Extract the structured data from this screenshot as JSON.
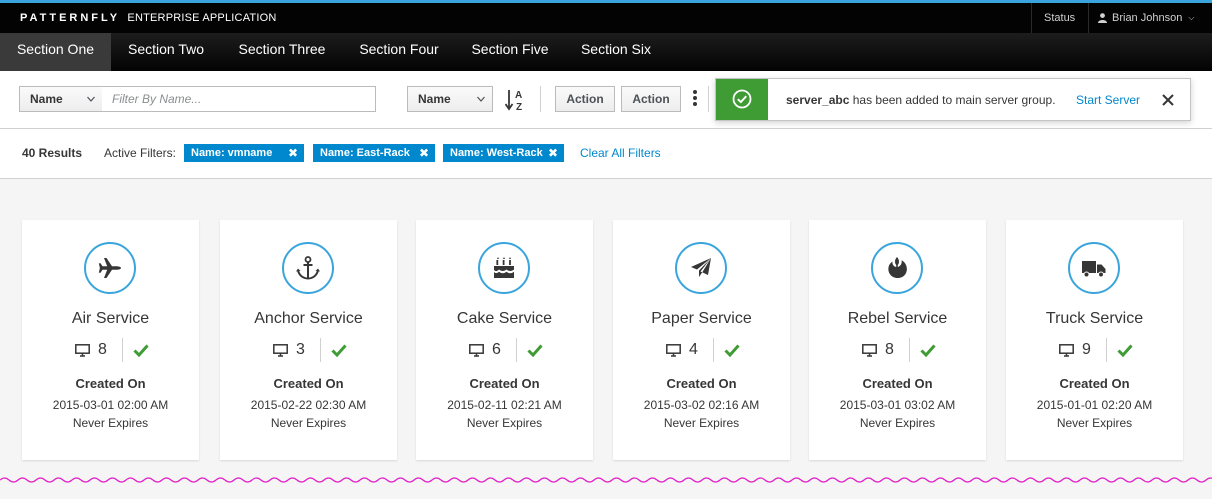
{
  "header": {
    "brand_main": "PATTERNFLY",
    "brand_sub": "ENTERPRISE APPLICATION",
    "status_label": "Status",
    "user_name": "Brian Johnson",
    "accent_color": "#39a5dc"
  },
  "nav": {
    "items": [
      {
        "label": "Section One",
        "active": true
      },
      {
        "label": "Section Two"
      },
      {
        "label": "Section Three"
      },
      {
        "label": "Section Four"
      },
      {
        "label": "Section Five"
      },
      {
        "label": "Section Six"
      }
    ]
  },
  "toolbar": {
    "filter_field": "Name",
    "filter_placeholder": "Filter By Name...",
    "sort_field": "Name",
    "sort_icon": "sort-alpha-asc-icon",
    "action1": "Action",
    "action2": "Action"
  },
  "toast": {
    "type": "success",
    "server": "server_abc",
    "message": " has been added to main server group.",
    "link": "Start Server",
    "color": "#3f9c35"
  },
  "results": {
    "count": "40 Results",
    "active_label": "Active Filters:",
    "chips": [
      "Name: vmname",
      "Name: East-Rack",
      "Name: West-Rack"
    ],
    "clear_label": "Clear All Filters",
    "chip_color": "#0088ce"
  },
  "cards": [
    {
      "title": "Air Service",
      "icon": "plane-icon",
      "count": "8",
      "created_label": "Created On",
      "date": "2015-03-01 02:00 AM",
      "expires": "Never Expires"
    },
    {
      "title": "Anchor Service",
      "icon": "anchor-icon",
      "count": "3",
      "created_label": "Created On",
      "date": "2015-02-22 02:30 AM",
      "expires": "Never Expires"
    },
    {
      "title": "Cake Service",
      "icon": "birthday-cake-icon",
      "count": "6",
      "created_label": "Created On",
      "date": "2015-02-11 02:21 AM",
      "expires": "Never Expires"
    },
    {
      "title": "Paper Service",
      "icon": "paper-plane-icon",
      "count": "4",
      "created_label": "Created On",
      "date": "2015-03-02 02:16 AM",
      "expires": "Never Expires"
    },
    {
      "title": "Rebel Service",
      "icon": "rebel-icon",
      "count": "8",
      "created_label": "Created On",
      "date": "2015-03-01 03:02 AM",
      "expires": "Never Expires"
    },
    {
      "title": "Truck Service",
      "icon": "truck-icon",
      "count": "9",
      "created_label": "Created On",
      "date": "2015-01-01 02:20 AM",
      "expires": "Never Expires"
    }
  ]
}
